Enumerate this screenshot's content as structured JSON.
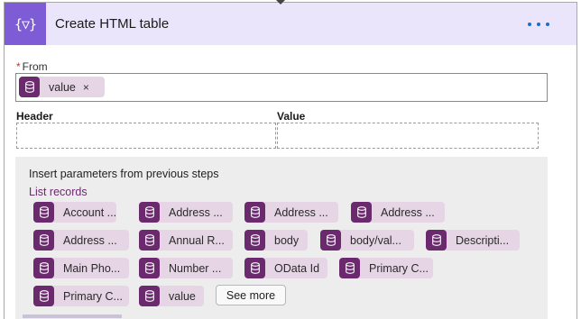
{
  "action": {
    "title": "Create HTML table",
    "icon": "curly-braces-function-icon"
  },
  "from": {
    "label": "From",
    "required_marker": "*",
    "token": {
      "label": "value",
      "remove": "×",
      "icon": "database-icon"
    }
  },
  "columns": {
    "header_label": "Header",
    "value_label": "Value"
  },
  "dynamic_content": {
    "title": "Insert parameters from previous steps",
    "group": "List records",
    "see_more": "See more",
    "tokens": [
      "Account ...",
      "Address ...",
      "Address ...",
      "Address ...",
      "Address ...",
      "Annual R...",
      "body",
      "body/val...",
      "Descripti...",
      "Main Pho...",
      "Number ...",
      "OData Id",
      "Primary C...",
      "Primary C...",
      "value"
    ]
  },
  "colors": {
    "header_bg": "#ebe5fb",
    "header_icon_bg": "#7d5cd6",
    "token_icon_bg": "#6b2a6e",
    "token_bg": "#e6d6e5",
    "link_purple": "#6b2a6e",
    "more_dots": "#1a6fc9"
  }
}
